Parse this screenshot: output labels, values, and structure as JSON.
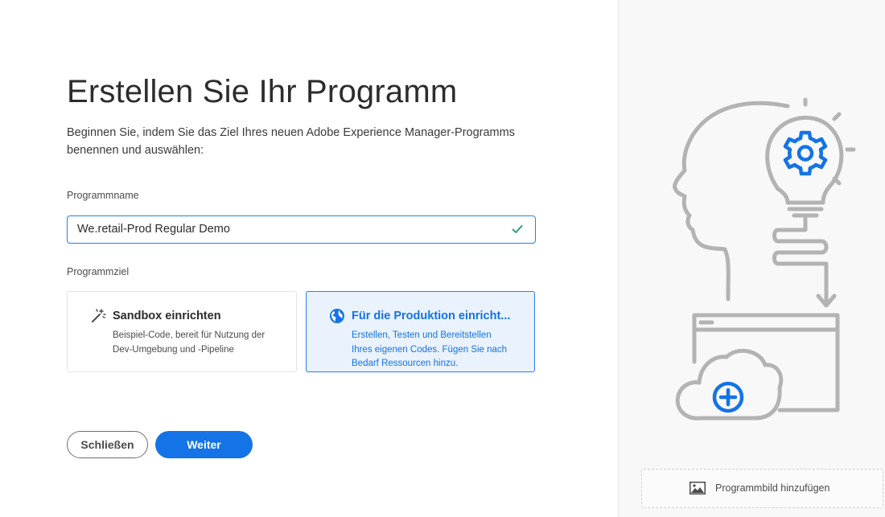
{
  "page": {
    "title": "Erstellen Sie Ihr Programm",
    "intro": "Beginnen Sie, indem Sie das Ziel Ihres neuen Adobe Experience Manager-Programms benennen und auswählen:"
  },
  "program_name": {
    "label": "Programmname",
    "value": "We.retail-Prod Regular Demo",
    "valid": true
  },
  "program_goal": {
    "label": "Programmziel",
    "options": [
      {
        "title": "Sandbox einrichten",
        "description": "Beispiel-Code, bereit für Nutzung der Dev-Umgebung und -Pipeline",
        "icon": "magic-wand-icon",
        "selected": false
      },
      {
        "title": "Für die Produktion einricht...",
        "description": "Erstellen, Testen und Bereitstellen Ihres eigenen Codes. Fügen Sie nach Bedarf Ressourcen hinzu.",
        "icon": "globe-icon",
        "selected": true
      }
    ]
  },
  "buttons": {
    "close": "Schließen",
    "next": "Weiter"
  },
  "sidebar": {
    "add_image_label": "Programmbild hinzufügen"
  },
  "colors": {
    "accent": "#1473e6",
    "selected_bg": "#e9f2fd",
    "valid": "#2d9d78",
    "illustration_gray": "#b3b3b3"
  }
}
